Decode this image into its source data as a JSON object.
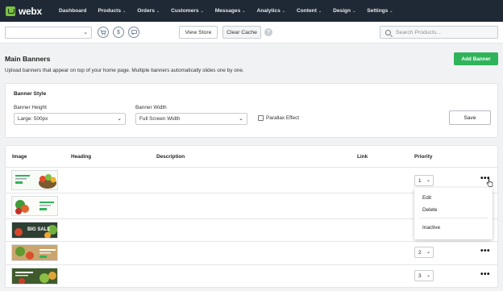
{
  "brand": {
    "name": "webx",
    "accent": "#7ac142",
    "nav_bg": "#1f2935"
  },
  "nav": [
    {
      "label": "Dashboard",
      "has_menu": false
    },
    {
      "label": "Products",
      "has_menu": true
    },
    {
      "label": "Orders",
      "has_menu": true
    },
    {
      "label": "Customers",
      "has_menu": true
    },
    {
      "label": "Messages",
      "has_menu": true
    },
    {
      "label": "Analytics",
      "has_menu": true
    },
    {
      "label": "Content",
      "has_menu": true
    },
    {
      "label": "Design",
      "has_menu": true
    },
    {
      "label": "Settings",
      "has_menu": true
    }
  ],
  "toolbar": {
    "store_select_value": "",
    "icons": [
      "cart-icon",
      "dollar-icon",
      "chat-icon"
    ],
    "view_store_label": "View Store",
    "clear_cache_label": "Clear Cache",
    "search_placeholder": "Search Products..."
  },
  "page": {
    "title": "Main Banners",
    "subtitle": "Upload banners that appear on top of your home page. Multiple banners automatically slides one by one.",
    "add_button_label": "Add Banner",
    "add_button_color": "#2fb45a"
  },
  "banner_style": {
    "title": "Banner Style",
    "height_label": "Banner Height",
    "height_value": "Large: 500px",
    "width_label": "Banner Width",
    "width_value": "Full Screen Width",
    "parallax_label": "Parallax Effect",
    "parallax_checked": false,
    "save_label": "Save"
  },
  "table": {
    "columns": [
      "Image",
      "Heading",
      "Description",
      "Link",
      "Priority"
    ],
    "rows": [
      {
        "thumb_text": "",
        "heading": "",
        "description": "",
        "link": "",
        "priority": "1"
      },
      {
        "thumb_text": "",
        "heading": "",
        "description": "",
        "link": "",
        "priority": ""
      },
      {
        "thumb_text": "BIG SALE",
        "heading": "",
        "description": "",
        "link": "",
        "priority": ""
      },
      {
        "thumb_text": "",
        "heading": "",
        "description": "",
        "link": "",
        "priority": "2"
      },
      {
        "thumb_text": "",
        "heading": "",
        "description": "",
        "link": "",
        "priority": "3"
      }
    ]
  },
  "row_menu": {
    "items": [
      "Edit",
      "Delete",
      "Inactive"
    ]
  }
}
